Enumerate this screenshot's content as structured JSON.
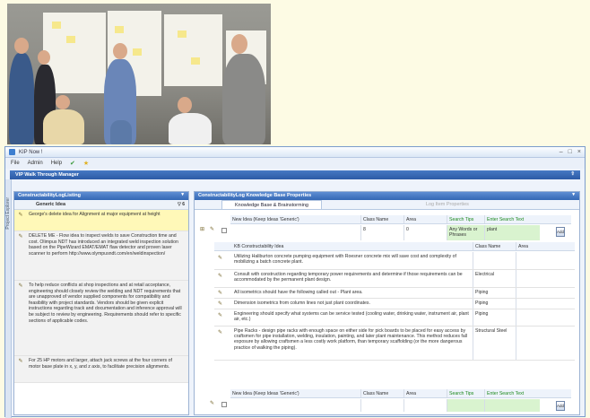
{
  "window": {
    "title": "KIP Now !",
    "controls": [
      "–",
      "□",
      "×"
    ]
  },
  "menu": {
    "items": [
      "File",
      "Admin",
      "Help"
    ],
    "ok_icon": "✔",
    "star_icon": "★"
  },
  "nav": {
    "title": "VIP Walk Through Manager",
    "pin": "⇧"
  },
  "side_tab": {
    "label": "Project Explorer"
  },
  "left_panel": {
    "title": "ConstructabilityLogListing",
    "chevron": "▾",
    "column": "Generic Idea",
    "filter": "▽ 6",
    "ideas": [
      {
        "text": "George's delete idea for Alignment at major equipment at height",
        "style": "hl"
      },
      {
        "text": "DELETE ME - Flow idea to inspect welds to save Construction time and cost. Olimpus NDT has introduced an integrated weld inspection solution based on the PipeWizard EMAT/EMAT flaw detector and proven laser scanner to perform http://www.olympusndt.com/en/weldinspection/",
        "style": "gr"
      },
      {
        "text": "To help reduce conflicts at shop inspections and at retail acceptance, engineering should closely review the welding and NDT requirements that are unapproved of vendor supplied components for compatibility and feasibility with project standards. Vendors should be given explicit instructions regarding track and documentation and inference approval will be subject to review by engineering. Requirements should refer to specific sections of applicable codes.",
        "style": "gr"
      },
      {
        "text": "For 25 HP motors and larger, attach jack screws at the four corners of motor base plate in x, y, and z axis, to facilitate precision alignments.",
        "style": "gr"
      }
    ]
  },
  "right_panel": {
    "title": "ConstructabilityLog Knowledge Base   Properties",
    "tabs": [
      "Knowledge Base & Brainstorming",
      "Log Item Properties"
    ],
    "new_idea": {
      "columns": [
        "New Idea (Keep Ideas 'Generic')",
        "Class Name",
        "Area",
        "Search Tips",
        "Enter Search Text"
      ],
      "values": [
        "",
        "8",
        "0",
        "Any Words or Phrases",
        "plant"
      ],
      "button": "Add"
    },
    "kb": {
      "columns": [
        "KB Constructability Idea",
        "Class Name",
        "Area"
      ],
      "rows": [
        {
          "idea": "Utilizing Haliburton concrete pumping equipment with Roesner concrete mix will save cost and complexity of mobilizing a batch concrete plant.",
          "class": "",
          "area": ""
        },
        {
          "idea": "Consult with construction regarding temporary power requirements and determine if those requirements can be accommodated by the permanent plant design.",
          "class": "Electrical",
          "area": ""
        },
        {
          "idea": "All isometrics should have the following called out - Plant area.",
          "class": "Piping",
          "area": ""
        },
        {
          "idea": "Dimension isometrics from column lines not just plant coordinates.",
          "class": "Piping",
          "area": ""
        },
        {
          "idea": "Engineering should specify what systems can be service tested (cooling water, drinking water, instrument air, plant air, etc.)",
          "class": "Piping",
          "area": ""
        },
        {
          "idea": "Pipe Racks - design pipe racks with enough space on either side for pick boards to be placed for easy access by craftsmen for pipe installation, welding, insulation, painting, and later plant maintenance. This method reduces fall exposure by allowing craftsmen a less costly work platform, than temporary scaffolding (or the more dangerous practice of walking the piping).",
          "class": "Structural Steel",
          "area": ""
        }
      ]
    },
    "bottom": {
      "columns": [
        "New Idea (Keep Ideas 'Generic')",
        "Class Name",
        "Area",
        "Search Tips",
        "Enter Search Text"
      ],
      "button": "Add"
    }
  }
}
